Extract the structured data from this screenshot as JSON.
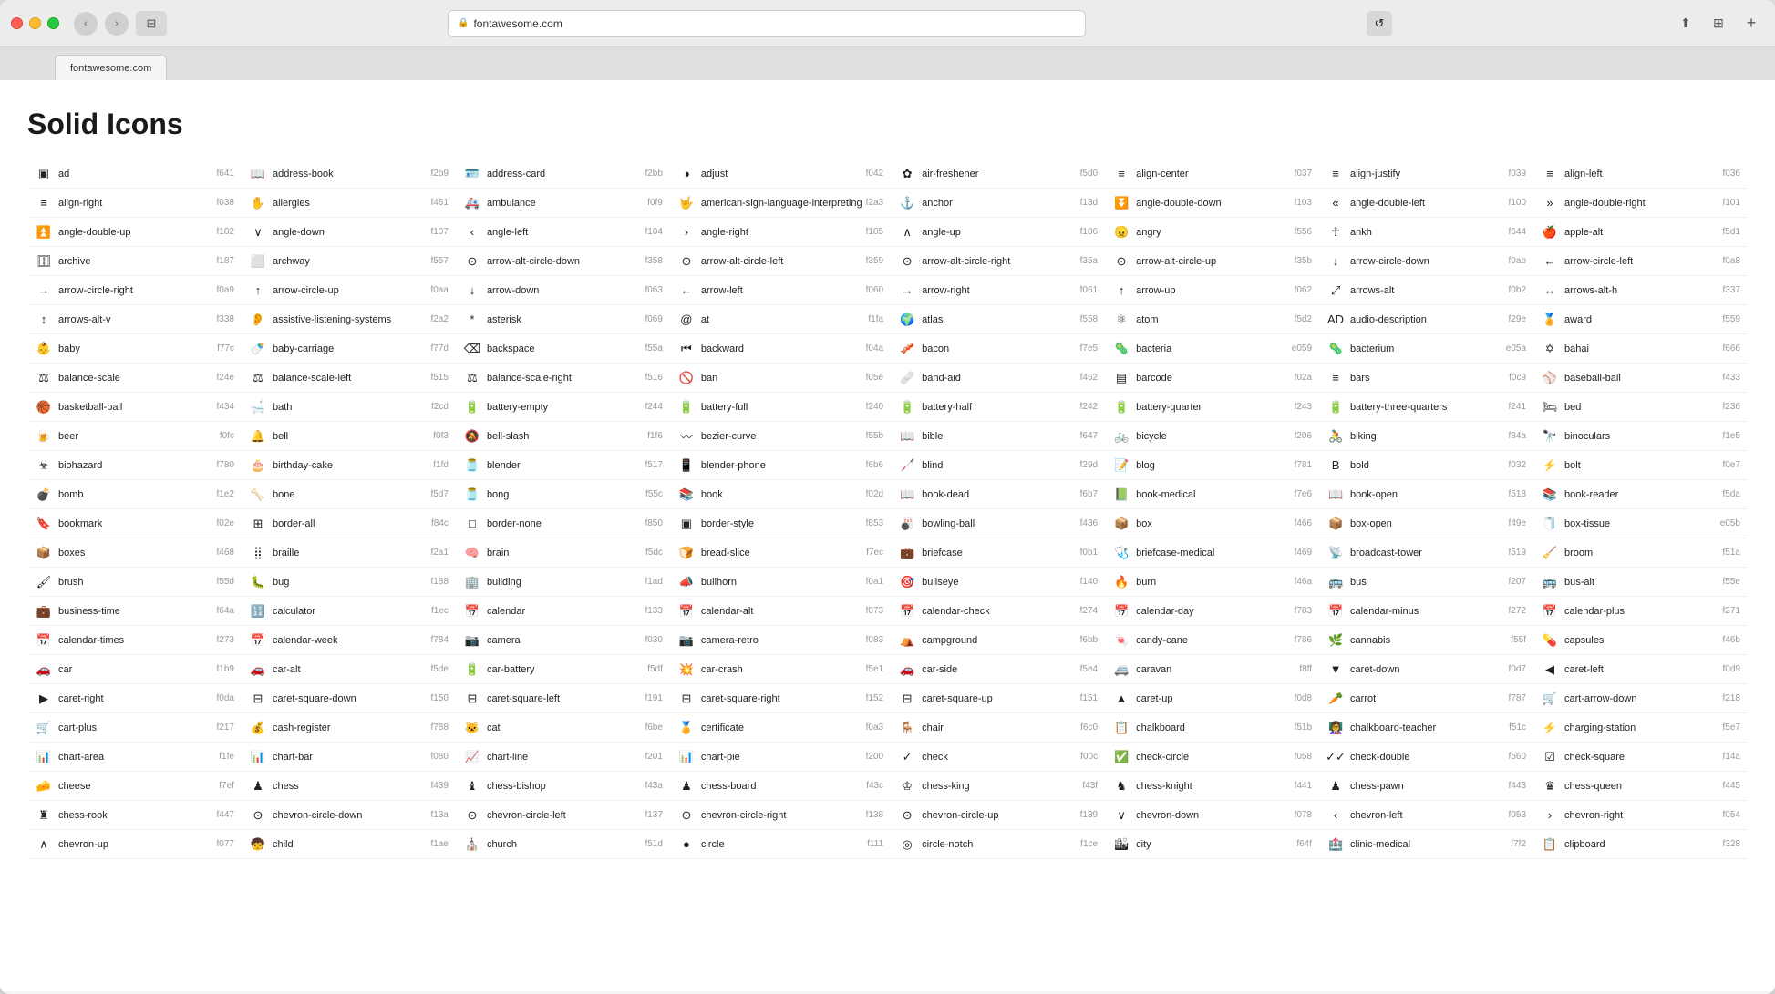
{
  "window": {
    "title": "fontawesome.com",
    "tab_label": "fontawesome.com"
  },
  "page": {
    "heading": "Solid Icons"
  },
  "icons": [
    {
      "name": "ad",
      "code": "f641",
      "symbol": "▣"
    },
    {
      "name": "address-book",
      "code": "f2b9",
      "symbol": "📖"
    },
    {
      "name": "address-card",
      "code": "f2bb",
      "symbol": "🪪"
    },
    {
      "name": "adjust",
      "code": "f042",
      "symbol": "◑"
    },
    {
      "name": "air-freshener",
      "code": "f5d0",
      "symbol": "✿"
    },
    {
      "name": "align-center",
      "code": "f037",
      "symbol": "≡"
    },
    {
      "name": "align-justify",
      "code": "f039",
      "symbol": "≡"
    },
    {
      "name": "align-left",
      "code": "f036",
      "symbol": "≡"
    },
    {
      "name": "align-right",
      "code": "f038",
      "symbol": "≡"
    },
    {
      "name": "allergies",
      "code": "f461",
      "symbol": "✋"
    },
    {
      "name": "ambulance",
      "code": "f0f9",
      "symbol": "🚑"
    },
    {
      "name": "american-sign-language-interpreting",
      "code": "f2a3",
      "symbol": "🤟"
    },
    {
      "name": "anchor",
      "code": "f13d",
      "symbol": "⚓"
    },
    {
      "name": "angle-double-down",
      "code": "f103",
      "symbol": "⏬"
    },
    {
      "name": "angle-double-left",
      "code": "f100",
      "symbol": "«"
    },
    {
      "name": "angle-double-right",
      "code": "f101",
      "symbol": "»"
    },
    {
      "name": "angle-double-up",
      "code": "f102",
      "symbol": "⏫"
    },
    {
      "name": "angle-down",
      "code": "f107",
      "symbol": "∨"
    },
    {
      "name": "angle-left",
      "code": "f104",
      "symbol": "‹"
    },
    {
      "name": "angle-right",
      "code": "f105",
      "symbol": "›"
    },
    {
      "name": "angle-up",
      "code": "f106",
      "symbol": "∧"
    },
    {
      "name": "angry",
      "code": "f556",
      "symbol": "😠"
    },
    {
      "name": "ankh",
      "code": "f644",
      "symbol": "☥"
    },
    {
      "name": "apple-alt",
      "code": "f5d1",
      "symbol": "🍎"
    },
    {
      "name": "archive",
      "code": "f187",
      "symbol": "🗄"
    },
    {
      "name": "archway",
      "code": "f557",
      "symbol": "⬜"
    },
    {
      "name": "arrow-alt-circle-down",
      "code": "f358",
      "symbol": "⊙"
    },
    {
      "name": "arrow-alt-circle-left",
      "code": "f359",
      "symbol": "⊙"
    },
    {
      "name": "arrow-alt-circle-right",
      "code": "f35a",
      "symbol": "⊙"
    },
    {
      "name": "arrow-alt-circle-up",
      "code": "f35b",
      "symbol": "⊙"
    },
    {
      "name": "arrow-circle-down",
      "code": "f0ab",
      "symbol": "↓"
    },
    {
      "name": "arrow-circle-left",
      "code": "f0a8",
      "symbol": "←"
    },
    {
      "name": "arrow-circle-right",
      "code": "f0a9",
      "symbol": "→"
    },
    {
      "name": "arrow-circle-up",
      "code": "f0aa",
      "symbol": "↑"
    },
    {
      "name": "arrow-down",
      "code": "f063",
      "symbol": "↓"
    },
    {
      "name": "arrow-left",
      "code": "f060",
      "symbol": "←"
    },
    {
      "name": "arrow-right",
      "code": "f061",
      "symbol": "→"
    },
    {
      "name": "arrow-up",
      "code": "f062",
      "symbol": "↑"
    },
    {
      "name": "arrows-alt",
      "code": "f0b2",
      "symbol": "⤢"
    },
    {
      "name": "arrows-alt-h",
      "code": "f337",
      "symbol": "↔"
    },
    {
      "name": "arrows-alt-v",
      "code": "f338",
      "symbol": "↕"
    },
    {
      "name": "assistive-listening-systems",
      "code": "f2a2",
      "symbol": "👂"
    },
    {
      "name": "asterisk",
      "code": "f069",
      "symbol": "*"
    },
    {
      "name": "at",
      "code": "f1fa",
      "symbol": "@"
    },
    {
      "name": "atlas",
      "code": "f558",
      "symbol": "🌍"
    },
    {
      "name": "atom",
      "code": "f5d2",
      "symbol": "⚛"
    },
    {
      "name": "audio-description",
      "code": "f29e",
      "symbol": "AD"
    },
    {
      "name": "award",
      "code": "f559",
      "symbol": "🏅"
    },
    {
      "name": "baby",
      "code": "f77c",
      "symbol": "👶"
    },
    {
      "name": "baby-carriage",
      "code": "f77d",
      "symbol": "🍼"
    },
    {
      "name": "backspace",
      "code": "f55a",
      "symbol": "⌫"
    },
    {
      "name": "backward",
      "code": "f04a",
      "symbol": "⏮"
    },
    {
      "name": "bacon",
      "code": "f7e5",
      "symbol": "🥓"
    },
    {
      "name": "bacteria",
      "code": "e059",
      "symbol": "🦠"
    },
    {
      "name": "bacterium",
      "code": "e05a",
      "symbol": "🦠"
    },
    {
      "name": "bahai",
      "code": "f666",
      "symbol": "✡"
    },
    {
      "name": "balance-scale",
      "code": "f24e",
      "symbol": "⚖"
    },
    {
      "name": "balance-scale-left",
      "code": "f515",
      "symbol": "⚖"
    },
    {
      "name": "balance-scale-right",
      "code": "f516",
      "symbol": "⚖"
    },
    {
      "name": "ban",
      "code": "f05e",
      "symbol": "🚫"
    },
    {
      "name": "band-aid",
      "code": "f462",
      "symbol": "🩹"
    },
    {
      "name": "barcode",
      "code": "f02a",
      "symbol": "▤"
    },
    {
      "name": "bars",
      "code": "f0c9",
      "symbol": "≡"
    },
    {
      "name": "baseball-ball",
      "code": "f433",
      "symbol": "⚾"
    },
    {
      "name": "basketball-ball",
      "code": "f434",
      "symbol": "🏀"
    },
    {
      "name": "bath",
      "code": "f2cd",
      "symbol": "🛁"
    },
    {
      "name": "battery-empty",
      "code": "f244",
      "symbol": "🔋"
    },
    {
      "name": "battery-full",
      "code": "f240",
      "symbol": "🔋"
    },
    {
      "name": "battery-half",
      "code": "f242",
      "symbol": "🔋"
    },
    {
      "name": "battery-quarter",
      "code": "f243",
      "symbol": "🔋"
    },
    {
      "name": "battery-three-quarters",
      "code": "f241",
      "symbol": "🔋"
    },
    {
      "name": "bed",
      "code": "f236",
      "symbol": "🛏"
    },
    {
      "name": "beer",
      "code": "f0fc",
      "symbol": "🍺"
    },
    {
      "name": "bell",
      "code": "f0f3",
      "symbol": "🔔"
    },
    {
      "name": "bell-slash",
      "code": "f1f6",
      "symbol": "🔕"
    },
    {
      "name": "bezier-curve",
      "code": "f55b",
      "symbol": "〰"
    },
    {
      "name": "bible",
      "code": "f647",
      "symbol": "📖"
    },
    {
      "name": "bicycle",
      "code": "f206",
      "symbol": "🚲"
    },
    {
      "name": "biking",
      "code": "f84a",
      "symbol": "🚴"
    },
    {
      "name": "binoculars",
      "code": "f1e5",
      "symbol": "🔭"
    },
    {
      "name": "biohazard",
      "code": "f780",
      "symbol": "☣"
    },
    {
      "name": "birthday-cake",
      "code": "f1fd",
      "symbol": "🎂"
    },
    {
      "name": "blender",
      "code": "f517",
      "symbol": "🫙"
    },
    {
      "name": "blender-phone",
      "code": "f6b6",
      "symbol": "📱"
    },
    {
      "name": "blind",
      "code": "f29d",
      "symbol": "🦯"
    },
    {
      "name": "blog",
      "code": "f781",
      "symbol": "📝"
    },
    {
      "name": "bold",
      "code": "f032",
      "symbol": "B"
    },
    {
      "name": "bolt",
      "code": "f0e7",
      "symbol": "⚡"
    },
    {
      "name": "bomb",
      "code": "f1e2",
      "symbol": "💣"
    },
    {
      "name": "bone",
      "code": "f5d7",
      "symbol": "🦴"
    },
    {
      "name": "bong",
      "code": "f55c",
      "symbol": "🫙"
    },
    {
      "name": "book",
      "code": "f02d",
      "symbol": "📚"
    },
    {
      "name": "book-dead",
      "code": "f6b7",
      "symbol": "📖"
    },
    {
      "name": "book-medical",
      "code": "f7e6",
      "symbol": "📗"
    },
    {
      "name": "book-open",
      "code": "f518",
      "symbol": "📖"
    },
    {
      "name": "book-reader",
      "code": "f5da",
      "symbol": "📚"
    },
    {
      "name": "bookmark",
      "code": "f02e",
      "symbol": "🔖"
    },
    {
      "name": "border-all",
      "code": "f84c",
      "symbol": "⊞"
    },
    {
      "name": "border-none",
      "code": "f850",
      "symbol": "□"
    },
    {
      "name": "border-style",
      "code": "f853",
      "symbol": "▣"
    },
    {
      "name": "bowling-ball",
      "code": "f436",
      "symbol": "🎳"
    },
    {
      "name": "box",
      "code": "f466",
      "symbol": "📦"
    },
    {
      "name": "box-open",
      "code": "f49e",
      "symbol": "📦"
    },
    {
      "name": "box-tissue",
      "code": "e05b",
      "symbol": "🧻"
    },
    {
      "name": "boxes",
      "code": "f468",
      "symbol": "📦"
    },
    {
      "name": "braille",
      "code": "f2a1",
      "symbol": "⣿"
    },
    {
      "name": "brain",
      "code": "f5dc",
      "symbol": "🧠"
    },
    {
      "name": "bread-slice",
      "code": "f7ec",
      "symbol": "🍞"
    },
    {
      "name": "briefcase",
      "code": "f0b1",
      "symbol": "💼"
    },
    {
      "name": "briefcase-medical",
      "code": "f469",
      "symbol": "🩺"
    },
    {
      "name": "broadcast-tower",
      "code": "f519",
      "symbol": "📡"
    },
    {
      "name": "broom",
      "code": "f51a",
      "symbol": "🧹"
    },
    {
      "name": "brush",
      "code": "f55d",
      "symbol": "🖌"
    },
    {
      "name": "bug",
      "code": "f188",
      "symbol": "🐛"
    },
    {
      "name": "building",
      "code": "f1ad",
      "symbol": "🏢"
    },
    {
      "name": "bullhorn",
      "code": "f0a1",
      "symbol": "📣"
    },
    {
      "name": "bullseye",
      "code": "f140",
      "symbol": "🎯"
    },
    {
      "name": "burn",
      "code": "f46a",
      "symbol": "🔥"
    },
    {
      "name": "bus",
      "code": "f207",
      "symbol": "🚌"
    },
    {
      "name": "bus-alt",
      "code": "f55e",
      "symbol": "🚌"
    },
    {
      "name": "business-time",
      "code": "f64a",
      "symbol": "💼"
    },
    {
      "name": "calculator",
      "code": "f1ec",
      "symbol": "🔢"
    },
    {
      "name": "calendar",
      "code": "f133",
      "symbol": "📅"
    },
    {
      "name": "calendar-alt",
      "code": "f073",
      "symbol": "📅"
    },
    {
      "name": "calendar-check",
      "code": "f274",
      "symbol": "📅"
    },
    {
      "name": "calendar-day",
      "code": "f783",
      "symbol": "📅"
    },
    {
      "name": "calendar-minus",
      "code": "f272",
      "symbol": "📅"
    },
    {
      "name": "calendar-plus",
      "code": "f271",
      "symbol": "📅"
    },
    {
      "name": "calendar-times",
      "code": "f273",
      "symbol": "📅"
    },
    {
      "name": "calendar-week",
      "code": "f784",
      "symbol": "📅"
    },
    {
      "name": "camera",
      "code": "f030",
      "symbol": "📷"
    },
    {
      "name": "camera-retro",
      "code": "f083",
      "symbol": "📷"
    },
    {
      "name": "campground",
      "code": "f6bb",
      "symbol": "⛺"
    },
    {
      "name": "candy-cane",
      "code": "f786",
      "symbol": "🍬"
    },
    {
      "name": "cannabis",
      "code": "f55f",
      "symbol": "🌿"
    },
    {
      "name": "capsules",
      "code": "f46b",
      "symbol": "💊"
    },
    {
      "name": "car",
      "code": "f1b9",
      "symbol": "🚗"
    },
    {
      "name": "car-alt",
      "code": "f5de",
      "symbol": "🚗"
    },
    {
      "name": "car-battery",
      "code": "f5df",
      "symbol": "🔋"
    },
    {
      "name": "car-crash",
      "code": "f5e1",
      "symbol": "💥"
    },
    {
      "name": "car-side",
      "code": "f5e4",
      "symbol": "🚗"
    },
    {
      "name": "caravan",
      "code": "f8ff",
      "symbol": "🚐"
    },
    {
      "name": "caret-down",
      "code": "f0d7",
      "symbol": "▼"
    },
    {
      "name": "caret-left",
      "code": "f0d9",
      "symbol": "◀"
    },
    {
      "name": "caret-right",
      "code": "f0da",
      "symbol": "▶"
    },
    {
      "name": "caret-square-down",
      "code": "f150",
      "symbol": "⊟"
    },
    {
      "name": "caret-square-left",
      "code": "f191",
      "symbol": "⊟"
    },
    {
      "name": "caret-square-right",
      "code": "f152",
      "symbol": "⊟"
    },
    {
      "name": "caret-square-up",
      "code": "f151",
      "symbol": "⊟"
    },
    {
      "name": "caret-up",
      "code": "f0d8",
      "symbol": "▲"
    },
    {
      "name": "carrot",
      "code": "f787",
      "symbol": "🥕"
    },
    {
      "name": "cart-arrow-down",
      "code": "f218",
      "symbol": "🛒"
    },
    {
      "name": "cart-plus",
      "code": "f217",
      "symbol": "🛒"
    },
    {
      "name": "cash-register",
      "code": "f788",
      "symbol": "💰"
    },
    {
      "name": "cat",
      "code": "f6be",
      "symbol": "🐱"
    },
    {
      "name": "certificate",
      "code": "f0a3",
      "symbol": "🏅"
    },
    {
      "name": "chair",
      "code": "f6c0",
      "symbol": "🪑"
    },
    {
      "name": "chalkboard",
      "code": "f51b",
      "symbol": "📋"
    },
    {
      "name": "chalkboard-teacher",
      "code": "f51c",
      "symbol": "👩‍🏫"
    },
    {
      "name": "charging-station",
      "code": "f5e7",
      "symbol": "⚡"
    },
    {
      "name": "chart-area",
      "code": "f1fe",
      "symbol": "📊"
    },
    {
      "name": "chart-bar",
      "code": "f080",
      "symbol": "📊"
    },
    {
      "name": "chart-line",
      "code": "f201",
      "symbol": "📈"
    },
    {
      "name": "chart-pie",
      "code": "f200",
      "symbol": "📊"
    },
    {
      "name": "check",
      "code": "f00c",
      "symbol": "✓"
    },
    {
      "name": "check-circle",
      "code": "f058",
      "symbol": "✅"
    },
    {
      "name": "check-double",
      "code": "f560",
      "symbol": "✓✓"
    },
    {
      "name": "check-square",
      "code": "f14a",
      "symbol": "☑"
    },
    {
      "name": "cheese",
      "code": "f7ef",
      "symbol": "🧀"
    },
    {
      "name": "chess",
      "code": "f439",
      "symbol": "♟"
    },
    {
      "name": "chess-bishop",
      "code": "f43a",
      "symbol": "♝"
    },
    {
      "name": "chess-board",
      "code": "f43c",
      "symbol": "♟"
    },
    {
      "name": "chess-king",
      "code": "f43f",
      "symbol": "♔"
    },
    {
      "name": "chess-knight",
      "code": "f441",
      "symbol": "♞"
    },
    {
      "name": "chess-pawn",
      "code": "f443",
      "symbol": "♟"
    },
    {
      "name": "chess-queen",
      "code": "f445",
      "symbol": "♛"
    },
    {
      "name": "chess-rook",
      "code": "f447",
      "symbol": "♜"
    },
    {
      "name": "chevron-circle-down",
      "code": "f13a",
      "symbol": "⊙"
    },
    {
      "name": "chevron-circle-left",
      "code": "f137",
      "symbol": "⊙"
    },
    {
      "name": "chevron-circle-right",
      "code": "f138",
      "symbol": "⊙"
    },
    {
      "name": "chevron-circle-up",
      "code": "f139",
      "symbol": "⊙"
    },
    {
      "name": "chevron-down",
      "code": "f078",
      "symbol": "∨"
    },
    {
      "name": "chevron-left",
      "code": "f053",
      "symbol": "‹"
    },
    {
      "name": "chevron-right",
      "code": "f054",
      "symbol": "›"
    },
    {
      "name": "chevron-up",
      "code": "f077",
      "symbol": "∧"
    },
    {
      "name": "child",
      "code": "f1ae",
      "symbol": "🧒"
    },
    {
      "name": "church",
      "code": "f51d",
      "symbol": "⛪"
    },
    {
      "name": "circle",
      "code": "f111",
      "symbol": "●"
    },
    {
      "name": "circle-notch",
      "code": "f1ce",
      "symbol": "◎"
    },
    {
      "name": "city",
      "code": "f64f",
      "symbol": "🏙"
    },
    {
      "name": "clinic-medical",
      "code": "f7f2",
      "symbol": "🏥"
    },
    {
      "name": "clipboard",
      "code": "f328",
      "symbol": "📋"
    }
  ]
}
